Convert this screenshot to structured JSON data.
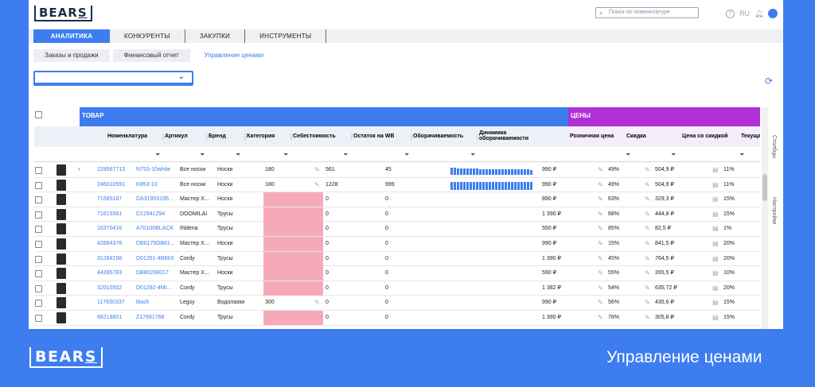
{
  "app": {
    "logo": "BEAR",
    "logo_last": "S",
    "search_placeholder": "Поиск по номенклатуре",
    "lang": "RU",
    "help": "?"
  },
  "tabs": [
    "АНАЛИТИКА",
    "КОНКУРЕНТЫ",
    "ЗАКУПКИ",
    "ИНСТРУМЕНТЫ"
  ],
  "subtabs": [
    "Заказы и продажи",
    "Финансовый отчет",
    "Управление ценами"
  ],
  "grid": {
    "band_product": "ТОВАР",
    "band_prices": "ЦЕНЫ",
    "columns": [
      "Номенклатура",
      "Артикул",
      "Бренд",
      "Категория",
      "Себестоимость",
      "Остаток на WB",
      "Оборачиваемость",
      "Динамика оборачиваемости",
      "Розничная цена",
      "Скидка",
      "Цена со скидкой",
      "Текущая СПП"
    ],
    "rows": [
      {
        "nm": "229567713",
        "art": "N753-10white",
        "brand": "Все носки",
        "cat": "Носки",
        "cost": "180",
        "stock": "561",
        "turn": "45",
        "price": "990 ₽",
        "disc": "49%",
        "sale": "504,9 ₽",
        "spp": "11%",
        "expand": true,
        "spark": [
          9,
          9,
          8,
          8,
          8,
          8,
          8,
          8,
          8,
          7,
          7,
          7,
          7,
          7,
          7,
          7,
          7,
          7,
          7,
          7,
          7,
          7,
          7,
          7,
          7,
          6
        ]
      },
      {
        "nm": "246010591",
        "art": "K853-10",
        "brand": "Все носки",
        "cat": "Носки",
        "cost": "180",
        "stock": "1228",
        "turn": "999",
        "price": "990 ₽",
        "disc": "49%",
        "sale": "504,9 ₽",
        "spp": "11%",
        "spark": [
          10,
          10,
          10,
          10,
          10,
          10,
          10,
          10,
          10,
          10,
          10,
          10,
          10,
          10,
          10,
          10,
          10,
          10,
          10,
          10,
          10,
          10,
          10,
          10,
          10,
          10
        ]
      },
      {
        "nm": "71585187",
        "art": "DA31953195...",
        "brand": "Мастер Х...",
        "cat": "Носки",
        "cost": "",
        "stock": "0",
        "turn": "0",
        "price": "890 ₽",
        "disc": "63%",
        "sale": "329,3 ₽",
        "spp": "15%"
      },
      {
        "nm": "71615581",
        "art": "D12941294",
        "brand": "DOOMILAI",
        "cat": "Трусы",
        "cost": "",
        "stock": "0",
        "turn": "0",
        "price": "1 390 ₽",
        "disc": "68%",
        "sale": "444,8 ₽",
        "spp": "15%"
      },
      {
        "nm": "16370416",
        "art": "A70100BLACK",
        "brand": "INdena",
        "cat": "Трусы",
        "cost": "",
        "stock": "0",
        "turn": "0",
        "price": "550 ₽",
        "disc": "85%",
        "sale": "82,5 ₽",
        "spp": "1%"
      },
      {
        "nm": "42884378",
        "art": "DB6175DB61...",
        "brand": "Мастер Х...",
        "cat": "Носки",
        "cost": "",
        "stock": "0",
        "turn": "0",
        "price": "990 ₽",
        "disc": "15%",
        "sale": "841,5 ₽",
        "spp": "20%"
      },
      {
        "nm": "31288158",
        "art": "D01261-4BMIX",
        "brand": "Cordy",
        "cat": "Трусы",
        "cost": "",
        "stock": "0",
        "turn": "0",
        "price": "1 390 ₽",
        "disc": "45%",
        "sale": "764,5 ₽",
        "spp": "20%"
      },
      {
        "nm": "44395783",
        "art": "DB80208017",
        "brand": "Мастер Х...",
        "cat": "Носки",
        "cost": "",
        "stock": "0",
        "turn": "0",
        "price": "590 ₽",
        "disc": "55%",
        "sale": "265,5 ₽",
        "spp": "10%"
      },
      {
        "nm": "32010502",
        "art": "D01292-4MI...",
        "brand": "Cordy",
        "cat": "Трусы",
        "cost": "",
        "stock": "0",
        "turn": "0",
        "price": "1 382 ₽",
        "disc": "54%",
        "sale": "635,72 ₽",
        "spp": "20%"
      },
      {
        "nm": "117630337",
        "art": "black",
        "brand": "Legsy",
        "cat": "Водолазки",
        "cost": "300",
        "stock": "0",
        "turn": "0",
        "price": "990 ₽",
        "disc": "56%",
        "sale": "435,6 ₽",
        "spp": "15%"
      },
      {
        "nm": "66218801",
        "art": "Z17681768",
        "brand": "Cordy",
        "cat": "Трусы",
        "cost": "",
        "stock": "0",
        "turn": "0",
        "price": "1 390 ₽",
        "disc": "78%",
        "sale": "305,8 ₽",
        "spp": "15%"
      },
      {
        "nm": "",
        "art": "",
        "brand": "",
        "cat": "",
        "cost": "",
        "stock": "",
        "turn": "",
        "price": "",
        "disc": "",
        "sale": "",
        "spp": ""
      }
    ]
  },
  "side": {
    "columns": "Столбцы",
    "settings": "Настройки"
  },
  "footer": {
    "logo": "BEAR",
    "logo_last": "S",
    "title": "Управление ценами"
  },
  "colors": {
    "accent": "#3d7df0",
    "prices_band": "#b12fd7",
    "cost_missing": "#f6aab8"
  }
}
